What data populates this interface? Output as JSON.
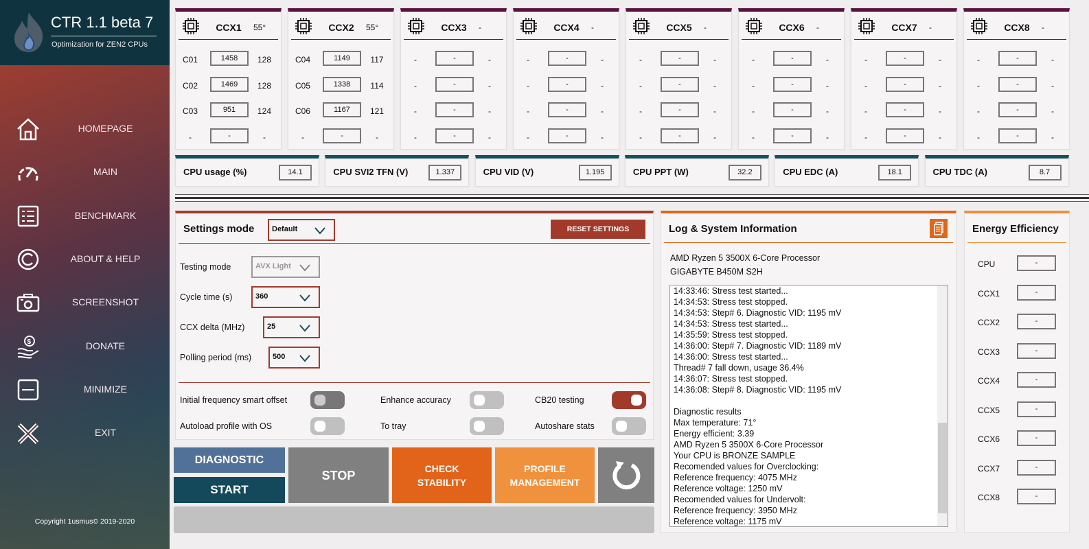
{
  "app": {
    "title": "CTR 1.1 beta 7",
    "subtitle": "Optimization for ZEN2 CPUs",
    "copyright": "Copyright 1usmus© 2019-2020"
  },
  "sidebar": {
    "items": [
      {
        "label": "HOMEPAGE",
        "icon": "home-icon"
      },
      {
        "label": "MAIN",
        "icon": "gauge-icon"
      },
      {
        "label": "BENCHMARK",
        "icon": "list-icon"
      },
      {
        "label": "ABOUT & HELP",
        "icon": "copyright-icon"
      },
      {
        "label": "SCREENSHOT",
        "icon": "camera-icon"
      },
      {
        "label": "DONATE",
        "icon": "donate-icon"
      },
      {
        "label": "MINIMIZE",
        "icon": "minimize-icon"
      },
      {
        "label": "EXIT",
        "icon": "close-icon"
      }
    ]
  },
  "ccx": [
    {
      "name": "CCX1",
      "temp": "55°",
      "cores": [
        {
          "label": "C01",
          "freq": "1458",
          "mhz": "128"
        },
        {
          "label": "C02",
          "freq": "1469",
          "mhz": "128"
        },
        {
          "label": "C03",
          "freq": "951",
          "mhz": "124"
        },
        {
          "label": "-",
          "freq": "-",
          "mhz": "-"
        }
      ]
    },
    {
      "name": "CCX2",
      "temp": "55°",
      "cores": [
        {
          "label": "C04",
          "freq": "1149",
          "mhz": "117"
        },
        {
          "label": "C05",
          "freq": "1338",
          "mhz": "114"
        },
        {
          "label": "C06",
          "freq": "1167",
          "mhz": "121"
        },
        {
          "label": "-",
          "freq": "-",
          "mhz": "-"
        }
      ]
    },
    {
      "name": "CCX3",
      "temp": "-",
      "cores": [
        {
          "label": "-",
          "freq": "-",
          "mhz": "-"
        },
        {
          "label": "-",
          "freq": "-",
          "mhz": "-"
        },
        {
          "label": "-",
          "freq": "-",
          "mhz": "-"
        },
        {
          "label": "-",
          "freq": "-",
          "mhz": "-"
        }
      ]
    },
    {
      "name": "CCX4",
      "temp": "-",
      "cores": [
        {
          "label": "-",
          "freq": "-",
          "mhz": "-"
        },
        {
          "label": "-",
          "freq": "-",
          "mhz": "-"
        },
        {
          "label": "-",
          "freq": "-",
          "mhz": "-"
        },
        {
          "label": "-",
          "freq": "-",
          "mhz": "-"
        }
      ]
    },
    {
      "name": "CCX5",
      "temp": "-",
      "cores": [
        {
          "label": "-",
          "freq": "-",
          "mhz": "-"
        },
        {
          "label": "-",
          "freq": "-",
          "mhz": "-"
        },
        {
          "label": "-",
          "freq": "-",
          "mhz": "-"
        },
        {
          "label": "-",
          "freq": "-",
          "mhz": "-"
        }
      ]
    },
    {
      "name": "CCX6",
      "temp": "-",
      "cores": [
        {
          "label": "-",
          "freq": "-",
          "mhz": "-"
        },
        {
          "label": "-",
          "freq": "-",
          "mhz": "-"
        },
        {
          "label": "-",
          "freq": "-",
          "mhz": "-"
        },
        {
          "label": "-",
          "freq": "-",
          "mhz": "-"
        }
      ]
    },
    {
      "name": "CCX7",
      "temp": "-",
      "cores": [
        {
          "label": "-",
          "freq": "-",
          "mhz": "-"
        },
        {
          "label": "-",
          "freq": "-",
          "mhz": "-"
        },
        {
          "label": "-",
          "freq": "-",
          "mhz": "-"
        },
        {
          "label": "-",
          "freq": "-",
          "mhz": "-"
        }
      ]
    },
    {
      "name": "CCX8",
      "temp": "-",
      "cores": [
        {
          "label": "-",
          "freq": "-",
          "mhz": "-"
        },
        {
          "label": "-",
          "freq": "-",
          "mhz": "-"
        },
        {
          "label": "-",
          "freq": "-",
          "mhz": "-"
        },
        {
          "label": "-",
          "freq": "-",
          "mhz": "-"
        }
      ]
    }
  ],
  "metrics": [
    {
      "label": "CPU usage (%)",
      "value": "14.1"
    },
    {
      "label": "CPU SVI2 TFN (V)",
      "value": "1.337"
    },
    {
      "label": "CPU VID (V)",
      "value": "1.195"
    },
    {
      "label": "CPU PPT (W)",
      "value": "32.2"
    },
    {
      "label": "CPU EDC (A)",
      "value": "18.1"
    },
    {
      "label": "CPU TDC (A)",
      "value": "8.7"
    }
  ],
  "settings": {
    "title": "Settings mode",
    "mode": "Default",
    "reset": "RESET SETTINGS",
    "fields": [
      {
        "label": "Testing mode",
        "value": "AVX Light"
      },
      {
        "label": "Cycle time (s)",
        "value": "360"
      },
      {
        "label": "CCX delta (MHz)",
        "value": "25"
      },
      {
        "label": "Polling period (ms)",
        "value": "500"
      }
    ],
    "toggles": [
      {
        "label": "Initial frequency smart offset",
        "state": "off-dark"
      },
      {
        "label": "Enhance accuracy",
        "state": "off"
      },
      {
        "label": "CB20 testing",
        "state": "on"
      },
      {
        "label": "Autoload profile with OS",
        "state": "off"
      },
      {
        "label": "To tray",
        "state": "off"
      },
      {
        "label": "Autoshare stats",
        "state": "off"
      }
    ]
  },
  "buttons": {
    "diagnostic": "DIAGNOSTIC",
    "start": "START",
    "stop": "STOP",
    "check1": "CHECK",
    "check2": "STABILITY",
    "profile1": "PROFILE",
    "profile2": "MANAGEMENT"
  },
  "progress": 0,
  "log": {
    "title": "Log & System Information",
    "cpu": "AMD Ryzen 5 3500X 6-Core Processor",
    "board": "GIGABYTE B450M S2H",
    "lines": [
      "14:33:46: Stress test started...",
      "14:34:53: Stress test stopped.",
      "14:34:53: Step# 6. Diagnostic VID: 1195 mV",
      "14:34:53: Stress test started...",
      "14:35:59: Stress test stopped.",
      "14:36:00: Step# 7. Diagnostic VID: 1189 mV",
      "14:36:00: Stress test started...",
      "Thread# 7 fall down, usage 36.4%",
      "14:36:07: Stress test stopped.",
      "14:36:08: Step# 8. Diagnostic VID: 1195 mV",
      "",
      "Diagnostic results",
      "Max temperature: 71°",
      "Energy efficient: 3.39",
      "AMD Ryzen 5 3500X 6-Core Processor",
      "Your CPU is BRONZE SAMPLE",
      "Recomended values for Overclocking:",
      "Reference frequency: 4075 MHz",
      "Reference voltage: 1250 mV",
      "Recomended values for Undervolt:",
      "Reference frequency: 3950 MHz",
      "Reference voltage: 1175 mV"
    ]
  },
  "energy": {
    "title": "Energy Efficiency",
    "rows": [
      {
        "label": "CPU",
        "value": "-"
      },
      {
        "label": "CCX1",
        "value": "-"
      },
      {
        "label": "CCX2",
        "value": "-"
      },
      {
        "label": "CCX3",
        "value": "-"
      },
      {
        "label": "CCX4",
        "value": "-"
      },
      {
        "label": "CCX5",
        "value": "-"
      },
      {
        "label": "CCX6",
        "value": "-"
      },
      {
        "label": "CCX7",
        "value": "-"
      },
      {
        "label": "CCX8",
        "value": "-"
      }
    ]
  },
  "colors": {
    "ccx_bar": "#5a1142",
    "metric_bar": "#13505c",
    "settings_bar": "#a23a2c",
    "log_bar": "#e0661a",
    "energy_bar": "#ef8f3a",
    "diagnostic": "#527199",
    "start": "#13495a",
    "stop": "#808080",
    "check": "#e2641a",
    "profile": "#ef913d"
  }
}
